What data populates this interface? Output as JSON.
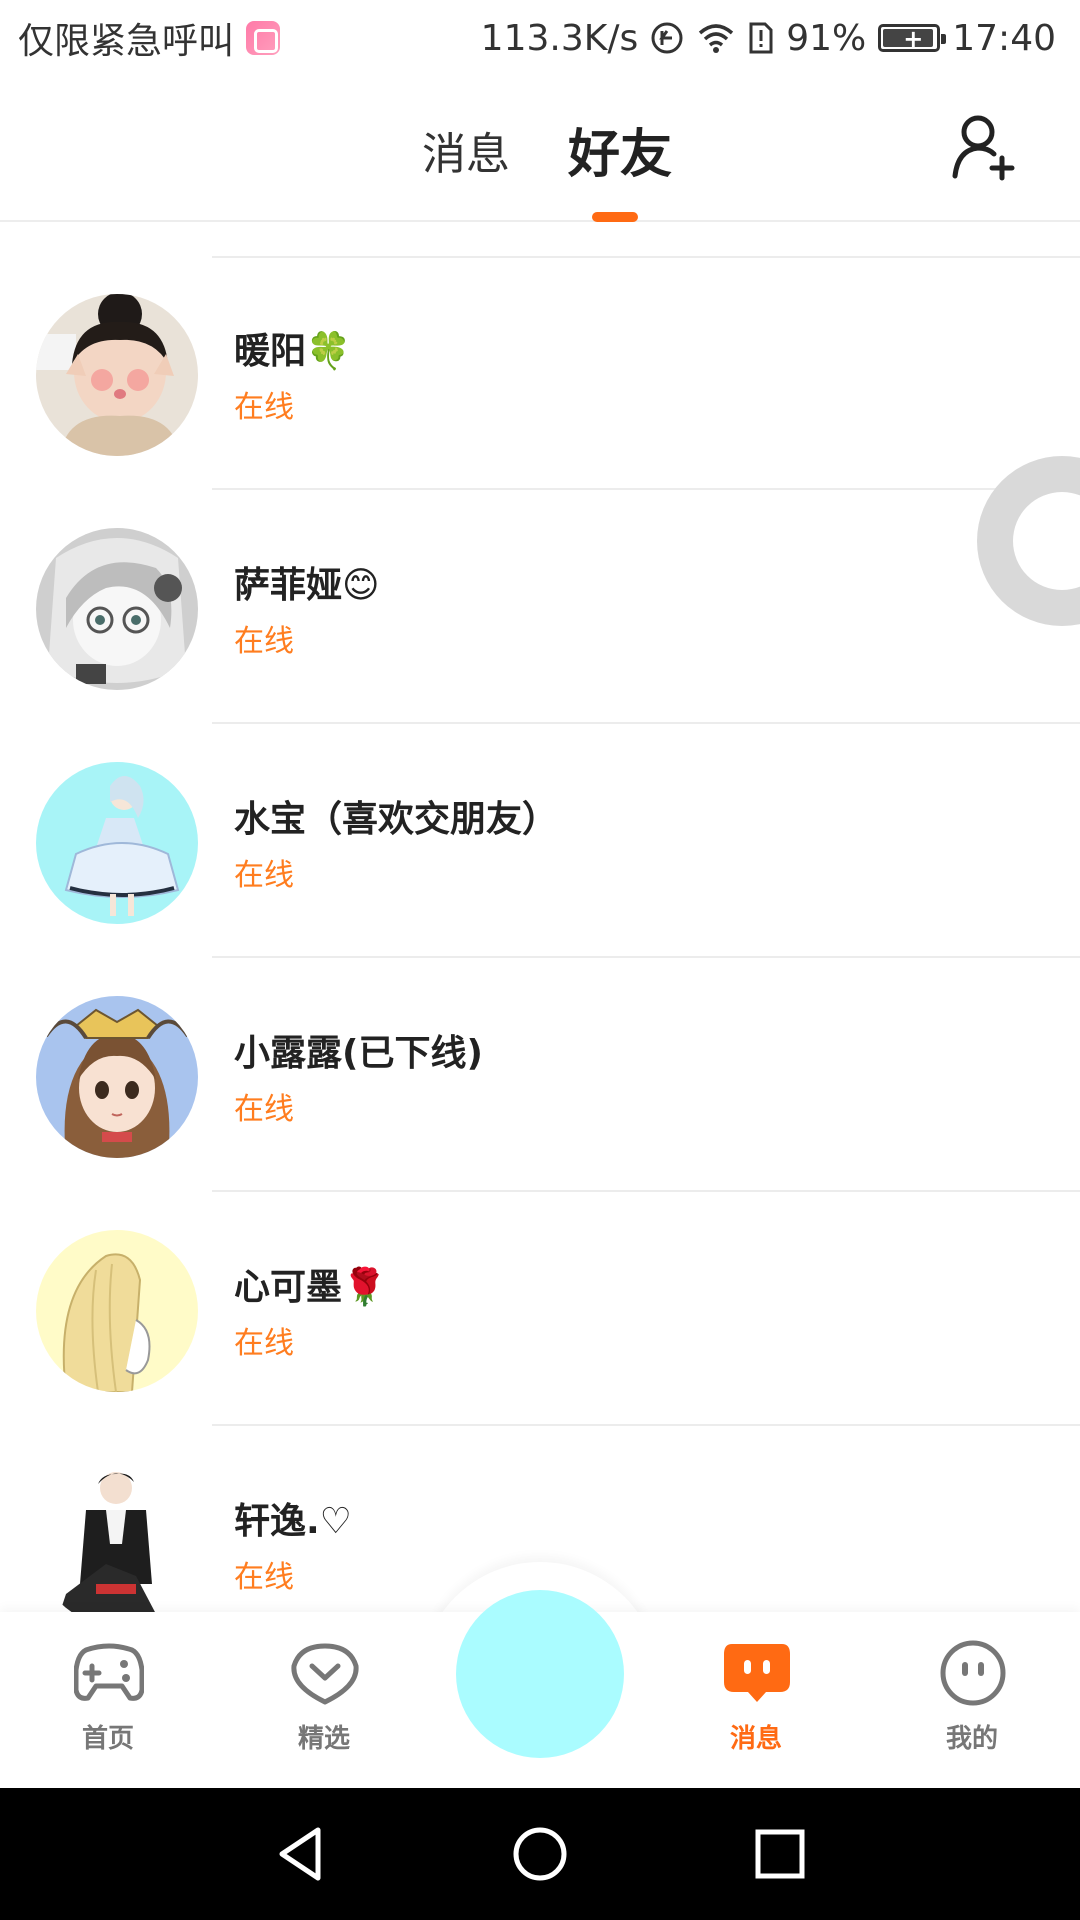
{
  "status_bar": {
    "carrier_text": "仅限紧急呼叫",
    "network_speed": "113.3K/s",
    "battery_percent": "91%",
    "time": "17:40",
    "icons": [
      "app-notification-icon",
      "data-saver-icon",
      "wifi-icon",
      "sim-alert-icon",
      "battery-icon"
    ]
  },
  "header": {
    "tabs": [
      {
        "label": "消息",
        "active": false
      },
      {
        "label": "好友",
        "active": true
      }
    ],
    "add_friend_icon": "add-user-icon",
    "accent_color": "#ff6a13"
  },
  "friends": [
    {
      "name": "暖阳🍀",
      "status": "在线"
    },
    {
      "name": "萨菲娅😊",
      "status": "在线"
    },
    {
      "name": "水宝（喜欢交朋友）",
      "status": "在线"
    },
    {
      "name": "小露露(已下线)",
      "status": "在线"
    },
    {
      "name": "心可墨🌹",
      "status": "在线"
    },
    {
      "name": "轩逸.♡",
      "status": "在线"
    }
  ],
  "bottom_nav": {
    "items": [
      {
        "label": "首页",
        "icon": "gamepad-icon",
        "active": false
      },
      {
        "label": "精选",
        "icon": "heart-chat-icon",
        "active": false
      },
      {
        "label": "消息",
        "icon": "message-icon",
        "active": true
      },
      {
        "label": "我的",
        "icon": "profile-face-icon",
        "active": false
      }
    ],
    "center_button_color": "#aafcff"
  },
  "system_nav": {
    "icons": [
      "back-icon",
      "home-icon",
      "recents-icon"
    ]
  }
}
